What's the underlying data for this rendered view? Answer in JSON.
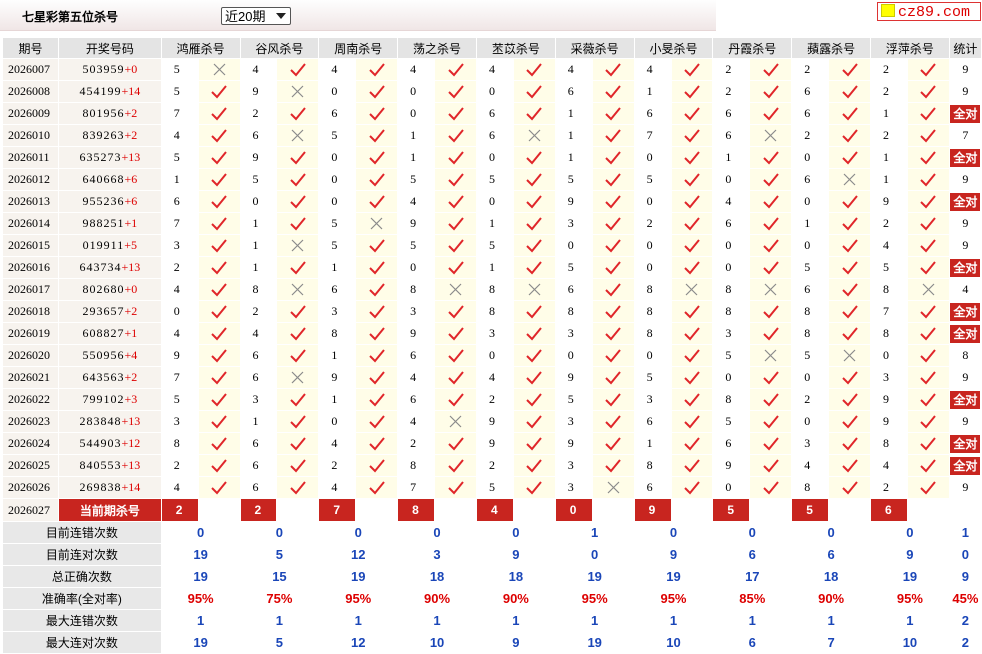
{
  "header": {
    "title": "七星彩第五位杀号",
    "select_value": "近20期",
    "logo": "cz89.com"
  },
  "columns": {
    "period": "期号",
    "numbers": "开奖号码",
    "experts": [
      "鸿雁杀号",
      "谷风杀号",
      "周南杀号",
      "荡之杀号",
      "苤苡杀号",
      "采薇杀号",
      "小旻杀号",
      "丹霞杀号",
      "蘋露杀号",
      "浮萍杀号"
    ],
    "stat": "统计"
  },
  "all_correct_label": "全对",
  "rows": [
    {
      "period": "2026007",
      "nums": "503959",
      "add": "+0",
      "k": [
        5,
        4,
        4,
        4,
        4,
        4,
        4,
        2,
        2,
        2
      ],
      "ok": [
        0,
        1,
        1,
        1,
        1,
        1,
        1,
        1,
        1,
        1
      ],
      "stat": "9"
    },
    {
      "period": "2026008",
      "nums": "454199",
      "add": "+14",
      "k": [
        5,
        9,
        0,
        0,
        0,
        6,
        1,
        2,
        6,
        2
      ],
      "ok": [
        1,
        0,
        1,
        1,
        1,
        1,
        1,
        1,
        1,
        1
      ],
      "stat": "9"
    },
    {
      "period": "2026009",
      "nums": "801956",
      "add": "+2",
      "k": [
        7,
        2,
        6,
        0,
        6,
        1,
        6,
        6,
        6,
        1
      ],
      "ok": [
        1,
        1,
        1,
        1,
        1,
        1,
        1,
        1,
        1,
        1
      ],
      "stat": "全对"
    },
    {
      "period": "2026010",
      "nums": "839263",
      "add": "+2",
      "k": [
        4,
        6,
        5,
        1,
        6,
        1,
        7,
        6,
        2,
        2
      ],
      "ok": [
        1,
        0,
        1,
        1,
        0,
        1,
        1,
        0,
        1,
        1
      ],
      "stat": "7"
    },
    {
      "period": "2026011",
      "nums": "635273",
      "add": "+13",
      "k": [
        5,
        9,
        0,
        1,
        0,
        1,
        0,
        1,
        0,
        1
      ],
      "ok": [
        1,
        1,
        1,
        1,
        1,
        1,
        1,
        1,
        1,
        1
      ],
      "stat": "全对"
    },
    {
      "period": "2026012",
      "nums": "640668",
      "add": "+6",
      "k": [
        1,
        5,
        0,
        5,
        5,
        5,
        5,
        0,
        6,
        1
      ],
      "ok": [
        1,
        1,
        1,
        1,
        1,
        1,
        1,
        1,
        0,
        1
      ],
      "stat": "9"
    },
    {
      "period": "2026013",
      "nums": "955236",
      "add": "+6",
      "k": [
        6,
        0,
        0,
        4,
        0,
        9,
        0,
        4,
        0,
        9
      ],
      "ok": [
        1,
        1,
        1,
        1,
        1,
        1,
        1,
        1,
        1,
        1
      ],
      "stat": "全对"
    },
    {
      "period": "2026014",
      "nums": "988251",
      "add": "+1",
      "k": [
        7,
        1,
        5,
        9,
        1,
        3,
        2,
        6,
        1,
        2
      ],
      "ok": [
        1,
        1,
        0,
        1,
        1,
        1,
        1,
        1,
        1,
        1
      ],
      "stat": "9"
    },
    {
      "period": "2026015",
      "nums": "019911",
      "add": "+5",
      "k": [
        3,
        1,
        5,
        5,
        5,
        0,
        0,
        0,
        0,
        4
      ],
      "ok": [
        1,
        0,
        1,
        1,
        1,
        1,
        1,
        1,
        1,
        1
      ],
      "stat": "9"
    },
    {
      "period": "2026016",
      "nums": "643734",
      "add": "+13",
      "k": [
        2,
        1,
        1,
        0,
        1,
        5,
        0,
        0,
        5,
        5
      ],
      "ok": [
        1,
        1,
        1,
        1,
        1,
        1,
        1,
        1,
        1,
        1
      ],
      "stat": "全对"
    },
    {
      "period": "2026017",
      "nums": "802680",
      "add": "+0",
      "k": [
        4,
        8,
        6,
        8,
        8,
        6,
        8,
        8,
        6,
        8
      ],
      "ok": [
        1,
        0,
        1,
        0,
        0,
        1,
        0,
        0,
        1,
        0
      ],
      "stat": "4"
    },
    {
      "period": "2026018",
      "nums": "293657",
      "add": "+2",
      "k": [
        0,
        2,
        3,
        3,
        8,
        8,
        8,
        8,
        8,
        7
      ],
      "ok": [
        1,
        1,
        1,
        1,
        1,
        1,
        1,
        1,
        1,
        1
      ],
      "stat": "全对"
    },
    {
      "period": "2026019",
      "nums": "608827",
      "add": "+1",
      "k": [
        4,
        4,
        8,
        9,
        3,
        3,
        8,
        3,
        8,
        8
      ],
      "ok": [
        1,
        1,
        1,
        1,
        1,
        1,
        1,
        1,
        1,
        1
      ],
      "stat": "全对"
    },
    {
      "period": "2026020",
      "nums": "550956",
      "add": "+4",
      "k": [
        9,
        6,
        1,
        6,
        0,
        0,
        0,
        5,
        5,
        0
      ],
      "ok": [
        1,
        1,
        1,
        1,
        1,
        1,
        1,
        0,
        0,
        1
      ],
      "stat": "8"
    },
    {
      "period": "2026021",
      "nums": "643563",
      "add": "+2",
      "k": [
        7,
        6,
        9,
        4,
        4,
        9,
        5,
        0,
        0,
        3
      ],
      "ok": [
        1,
        0,
        1,
        1,
        1,
        1,
        1,
        1,
        1,
        1
      ],
      "stat": "9"
    },
    {
      "period": "2026022",
      "nums": "799102",
      "add": "+3",
      "k": [
        5,
        3,
        1,
        6,
        2,
        5,
        3,
        8,
        2,
        9
      ],
      "ok": [
        1,
        1,
        1,
        1,
        1,
        1,
        1,
        1,
        1,
        1
      ],
      "stat": "全对"
    },
    {
      "period": "2026023",
      "nums": "283848",
      "add": "+13",
      "k": [
        3,
        1,
        0,
        4,
        9,
        3,
        6,
        5,
        0,
        9
      ],
      "ok": [
        1,
        1,
        1,
        0,
        1,
        1,
        1,
        1,
        1,
        1
      ],
      "stat": "9"
    },
    {
      "period": "2026024",
      "nums": "544903",
      "add": "+12",
      "k": [
        8,
        6,
        4,
        2,
        9,
        9,
        1,
        6,
        3,
        8
      ],
      "ok": [
        1,
        1,
        1,
        1,
        1,
        1,
        1,
        1,
        1,
        1
      ],
      "stat": "全对"
    },
    {
      "period": "2026025",
      "nums": "840553",
      "add": "+13",
      "k": [
        2,
        6,
        2,
        8,
        2,
        3,
        8,
        9,
        4,
        4
      ],
      "ok": [
        1,
        1,
        1,
        1,
        1,
        1,
        1,
        1,
        1,
        1
      ],
      "stat": "全对"
    },
    {
      "period": "2026026",
      "nums": "269838",
      "add": "+14",
      "k": [
        4,
        6,
        4,
        7,
        5,
        3,
        6,
        0,
        8,
        2
      ],
      "ok": [
        1,
        1,
        1,
        1,
        1,
        0,
        1,
        1,
        1,
        1
      ],
      "stat": "9"
    }
  ],
  "current": {
    "period": "2026027",
    "label": "当前期杀号",
    "k": [
      2,
      2,
      7,
      8,
      4,
      0,
      9,
      5,
      5,
      6
    ]
  },
  "summary": [
    {
      "label": "目前连错次数",
      "v": [
        "0",
        "0",
        "0",
        "0",
        "0",
        "1",
        "0",
        "0",
        "0",
        "0"
      ],
      "stat": "1",
      "color": "blue",
      "stat_color": "blue"
    },
    {
      "label": "目前连对次数",
      "v": [
        "19",
        "5",
        "12",
        "3",
        "9",
        "0",
        "9",
        "6",
        "6",
        "9"
      ],
      "stat": "0",
      "color": "blue",
      "stat_color": "blue"
    },
    {
      "label": "总正确次数",
      "v": [
        "19",
        "15",
        "19",
        "18",
        "18",
        "19",
        "19",
        "17",
        "18",
        "19"
      ],
      "stat": "9",
      "color": "blue",
      "stat_color": "blue"
    },
    {
      "label": "准确率(全对率)",
      "v": [
        "95%",
        "75%",
        "95%",
        "90%",
        "90%",
        "95%",
        "95%",
        "85%",
        "90%",
        "95%"
      ],
      "stat": "45%",
      "color": "red",
      "stat_color": "red"
    },
    {
      "label": "最大连错次数",
      "v": [
        "1",
        "1",
        "1",
        "1",
        "1",
        "1",
        "1",
        "1",
        "1",
        "1"
      ],
      "stat": "2",
      "color": "blue",
      "stat_color": "blue"
    },
    {
      "label": "最大连对次数",
      "v": [
        "19",
        "5",
        "12",
        "10",
        "9",
        "19",
        "10",
        "6",
        "7",
        "10"
      ],
      "stat": "2",
      "color": "blue",
      "stat_color": "blue"
    }
  ]
}
